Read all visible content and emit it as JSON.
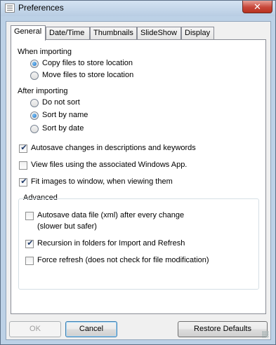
{
  "window": {
    "title": "Preferences",
    "close_symbol": "✕"
  },
  "tabs": [
    {
      "label": "General",
      "active": true
    },
    {
      "label": "Date/Time",
      "active": false
    },
    {
      "label": "Thumbnails",
      "active": false
    },
    {
      "label": "SlideShow",
      "active": false
    },
    {
      "label": "Display",
      "active": false
    }
  ],
  "importing": {
    "heading": "When importing",
    "options": [
      {
        "label": "Copy files to store location",
        "selected": true
      },
      {
        "label": "Move files to store location",
        "selected": false
      }
    ]
  },
  "after_importing": {
    "heading": "After importing",
    "options": [
      {
        "label": "Do not sort",
        "selected": false
      },
      {
        "label": "Sort by name",
        "selected": true
      },
      {
        "label": "Sort by date",
        "selected": false
      }
    ]
  },
  "checkboxes": [
    {
      "label": "Autosave changes in descriptions and keywords",
      "checked": true
    },
    {
      "label": "View files using the associated Windows App.",
      "checked": false
    },
    {
      "label": "Fit images to window, when viewing them",
      "checked": true
    }
  ],
  "advanced": {
    "title": "Advanced",
    "autosave": {
      "label": "Autosave data file (xml) after every change",
      "sublabel": "(slower but safer)",
      "checked": false
    },
    "recursion": {
      "label": "Recursion in folders for Import and Refresh",
      "checked": true
    },
    "force_refresh": {
      "label": "Force refresh (does not check for file modification)",
      "checked": false
    }
  },
  "buttons": {
    "ok": "OK",
    "cancel": "Cancel",
    "restore": "Restore Defaults"
  },
  "check_mark": "✔"
}
